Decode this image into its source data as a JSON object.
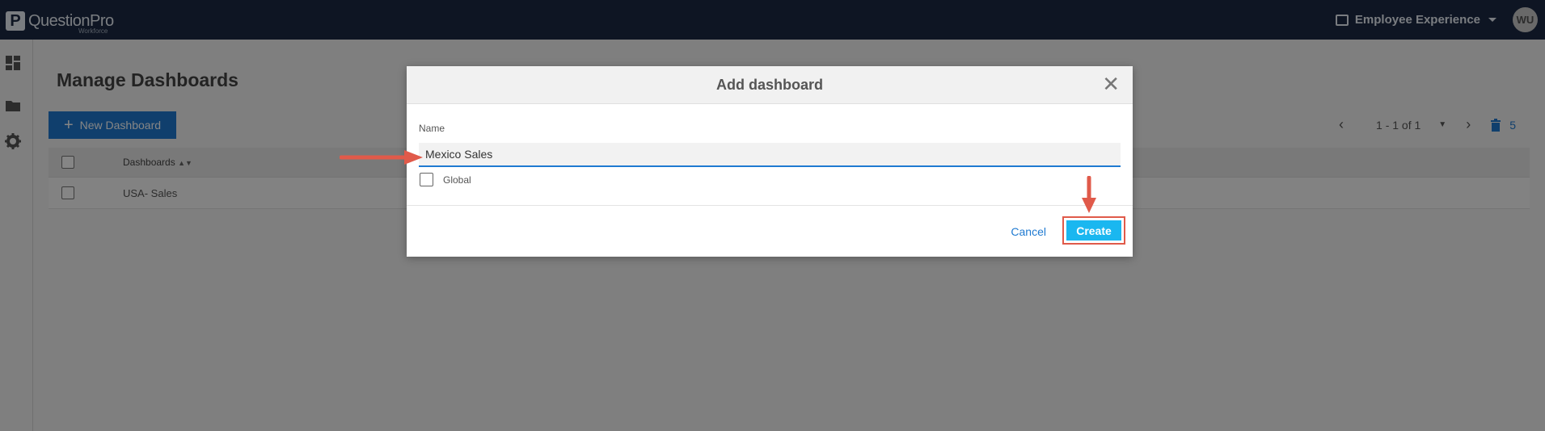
{
  "topbar": {
    "logo_letter": "P",
    "logo_text": "QuestionPro",
    "logo_sub": "Workforce",
    "product_label": "Employee Experience",
    "avatar_initials": "WU"
  },
  "rail": {
    "icons": [
      "dashboard-icon",
      "folder-icon",
      "gear-icon"
    ]
  },
  "page": {
    "title": "Manage Dashboards",
    "new_button": "New Dashboard",
    "pagination": "1 - 1 of 1",
    "trash_count": "5"
  },
  "table": {
    "header": "Dashboards",
    "rows": [
      "USA- Sales"
    ]
  },
  "modal": {
    "title": "Add dashboard",
    "name_label": "Name",
    "name_value": "Mexico Sales",
    "global_label": "Global",
    "cancel_label": "Cancel",
    "create_label": "Create"
  },
  "colors": {
    "topbar": "#1b2a44",
    "primary": "#1f7ad1",
    "create": "#1ab7f0",
    "annotation": "#e05a4a"
  }
}
